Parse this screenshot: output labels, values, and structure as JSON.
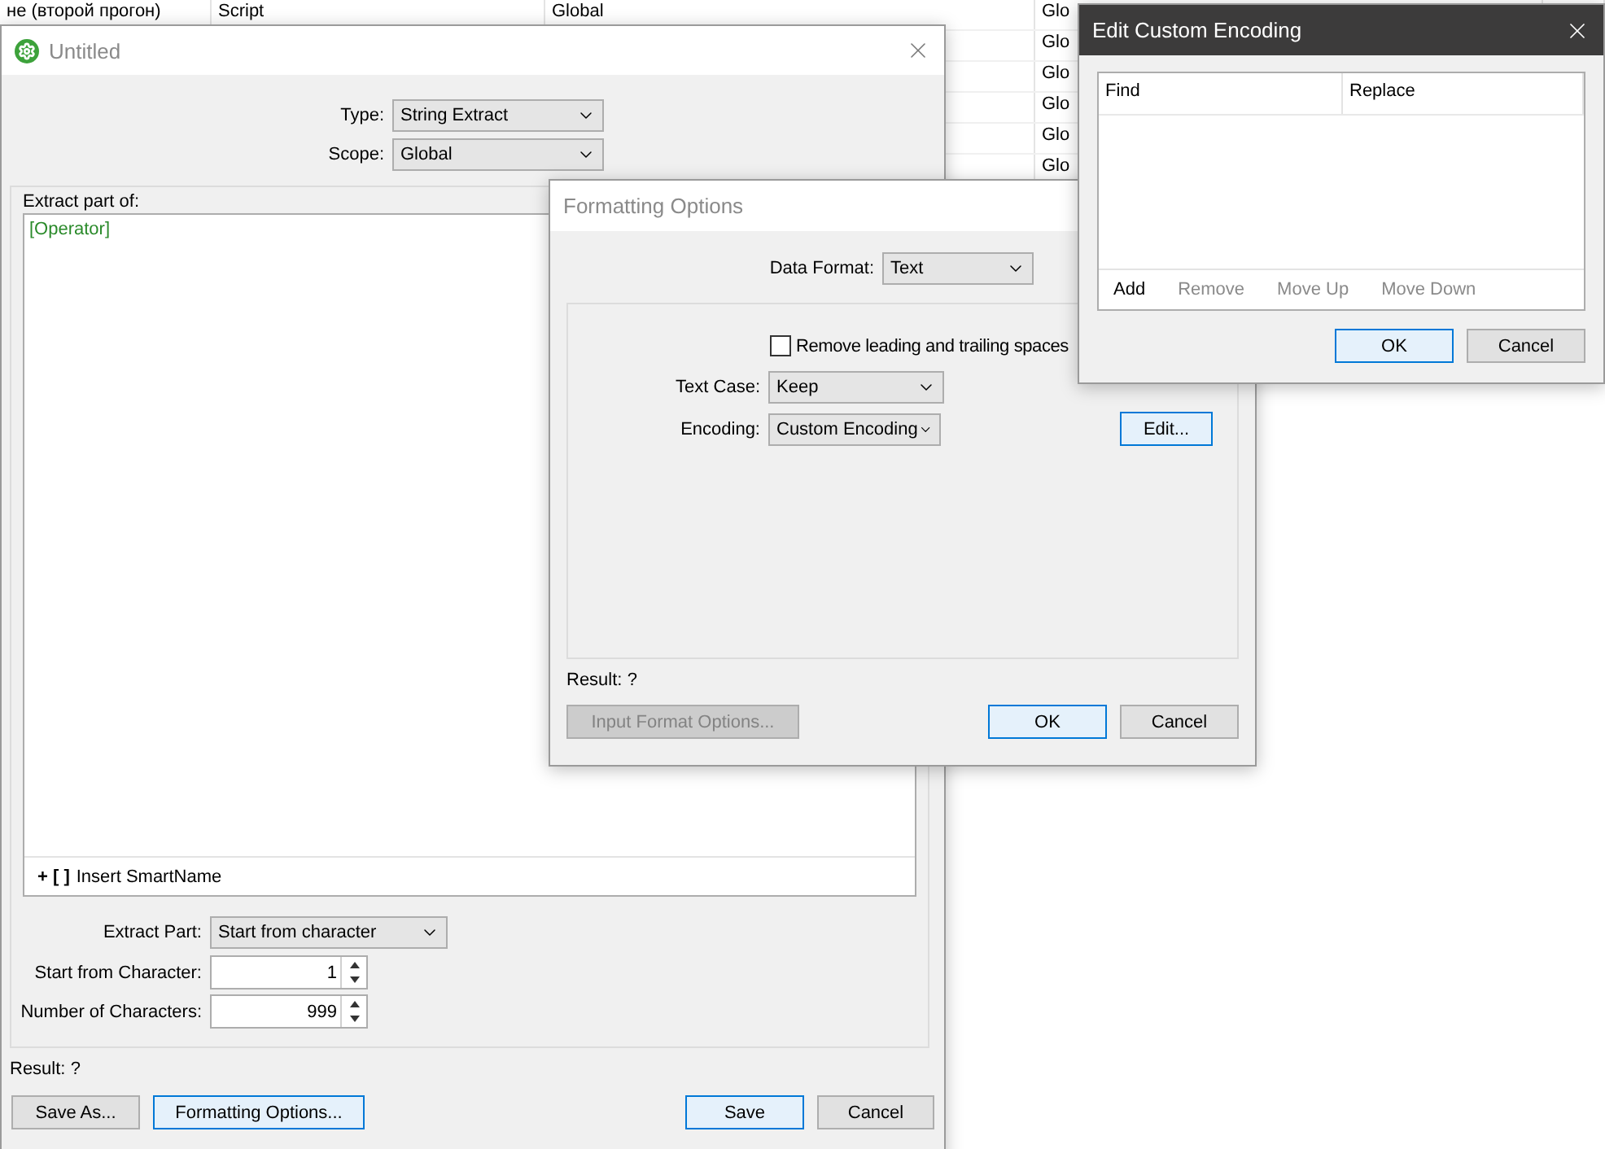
{
  "background_table": {
    "rows": [
      {
        "cells": [
          "не (второй прогон)",
          "Script",
          "Global",
          "Glo"
        ]
      },
      {
        "cells": [
          "",
          "",
          "",
          "Glo"
        ]
      },
      {
        "cells": [
          "",
          "",
          "",
          "Glo"
        ]
      },
      {
        "cells": [
          "",
          "",
          "",
          "Glo"
        ]
      },
      {
        "cells": [
          "",
          "",
          "",
          "Glo"
        ]
      },
      {
        "cells": [
          "",
          "",
          "",
          "Glo"
        ]
      }
    ]
  },
  "main_window": {
    "title": "Untitled",
    "top_fields": [
      {
        "label": "Type:",
        "value": "String Extract"
      },
      {
        "label": "Scope:",
        "value": "Global"
      }
    ],
    "group_label": "Extract part of:",
    "expression": "[Operator]",
    "insert_button": {
      "icon": "+ [ ]",
      "label": "Insert SmartName"
    },
    "fields": [
      {
        "kind": "select",
        "label": "Extract Part:",
        "value": "Start from character"
      },
      {
        "kind": "spinner",
        "label": "Start from Character:",
        "value": "1"
      },
      {
        "kind": "spinner",
        "label": "Number of Characters:",
        "value": "999"
      }
    ],
    "result": {
      "label": "Result:",
      "value": "?"
    },
    "left_buttons": [
      {
        "label": "Save As...",
        "default": false
      },
      {
        "label": "Formatting Options...",
        "default": true
      }
    ],
    "right_buttons": [
      {
        "label": "Save",
        "default": true
      },
      {
        "label": "Cancel",
        "default": false
      }
    ]
  },
  "formatting_window": {
    "title": "Formatting Options",
    "data_format": {
      "label": "Data Format:",
      "value": "Text"
    },
    "remove_spaces": {
      "label": "Remove leading and trailing spaces",
      "checked": false
    },
    "text_case": {
      "label": "Text Case:",
      "value": "Keep"
    },
    "encoding": {
      "label": "Encoding:",
      "value": "Custom Encoding"
    },
    "edit_button": {
      "label": "Edit...",
      "default": true
    },
    "result": {
      "label": "Result:",
      "value": "?"
    },
    "input_format_button": {
      "label": "Input Format Options...",
      "disabled": true
    },
    "buttons": [
      {
        "label": "OK",
        "default": true
      },
      {
        "label": "Cancel",
        "default": false
      }
    ]
  },
  "encoding_window": {
    "title": "Edit Custom Encoding",
    "columns": [
      "Find",
      "Replace"
    ],
    "toolbar": [
      {
        "label": "Add",
        "disabled": false
      },
      {
        "label": "Remove",
        "disabled": true
      },
      {
        "label": "Move Up",
        "disabled": true
      },
      {
        "label": "Move Down",
        "disabled": true
      }
    ],
    "buttons": [
      {
        "label": "OK",
        "default": true
      },
      {
        "label": "Cancel",
        "default": false
      }
    ]
  }
}
